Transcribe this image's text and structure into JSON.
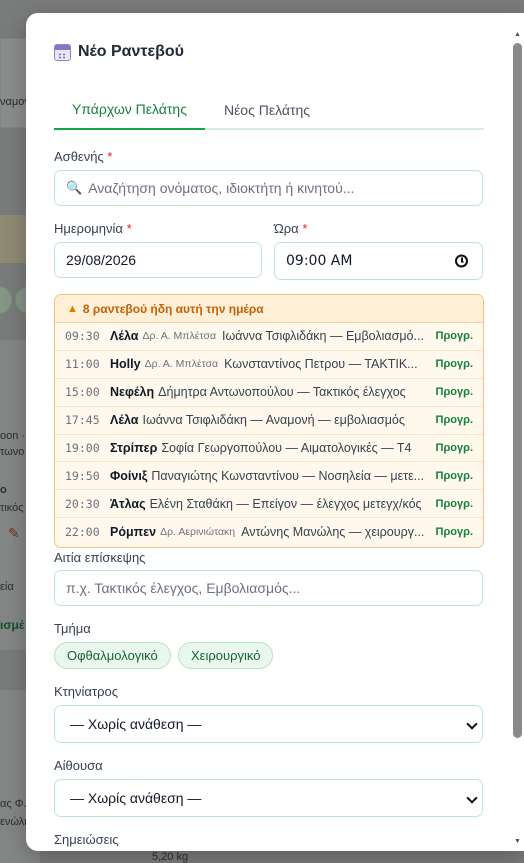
{
  "modal": {
    "title": "Νέο Ραντεβού",
    "tabs": [
      {
        "label": "Υπάρχων Πελάτης",
        "active": true
      },
      {
        "label": "Νέος Πελάτης",
        "active": false
      }
    ],
    "patient": {
      "label": "Ασθενής",
      "required_mark": "*",
      "search_icon": "magnifier-icon",
      "placeholder": "Αναζήτηση ονόματος, ιδιοκτήτη ή κινητού..."
    },
    "date": {
      "label": "Ημερομηνία",
      "required_mark": "*",
      "value": "29/08/2026"
    },
    "time": {
      "label": "Ώρα",
      "required_mark": "*",
      "value": "09:00 AM",
      "icon": "clock-icon"
    },
    "warning": {
      "icon": "warning-triangle-icon",
      "text": "8 ραντεβού ήδη αυτή την ημέρα",
      "appointments": [
        {
          "time": "09:30",
          "pet": "Λέλα",
          "vet": "Δρ. Α. Μπλέτσα",
          "desc": "Ιωάννα Τσιφλιδάκη — Εμβολιασμό...",
          "status": "Προγρ."
        },
        {
          "time": "11:00",
          "pet": "Holly",
          "vet": "Δρ. Α. Μπλέτσα",
          "desc": "Κωνσταντίνος Πετρου — ΤΑΚΤΙΚ...",
          "status": "Προγρ."
        },
        {
          "time": "15:00",
          "pet": "Νεφέλη",
          "vet": "",
          "desc": "Δήμητρα Αντωνοπούλου — Τακτικός έλεγχος",
          "status": "Προγρ."
        },
        {
          "time": "17:45",
          "pet": "Λέλα",
          "vet": "",
          "desc": "Ιωάννα Τσιφλιδάκη — Αναμονή — εμβολιασμός",
          "status": "Προγρ."
        },
        {
          "time": "19:00",
          "pet": "Στρίπερ",
          "vet": "",
          "desc": "Σοφία Γεωργοπούλου — Αιματολογικές — Τ4",
          "status": "Προγρ."
        },
        {
          "time": "19:50",
          "pet": "Φοίνιξ",
          "vet": "",
          "desc": "Παναγιώτης Κωνσταντίνου — Νοσηλεία — μετε...",
          "status": "Προγρ."
        },
        {
          "time": "20:30",
          "pet": "Άτλας",
          "vet": "",
          "desc": "Ελένη Σταθάκη — Επείγον — έλεγχος μετεγχ/κός",
          "status": "Προγρ."
        },
        {
          "time": "22:00",
          "pet": "Ρόμπεν",
          "vet": "Δρ. Αερινιώτακη",
          "desc": "Αντώνης Μανώλης — χειρουργ...",
          "status": "Προγρ."
        }
      ]
    },
    "reason": {
      "label": "Αιτία επίσκεψης",
      "placeholder": "π.χ. Τακτικός έλεγχος, Εμβολιασμός..."
    },
    "department": {
      "label": "Τμήμα",
      "options": [
        "Οφθαλμολογικό",
        "Χειρουργικό"
      ]
    },
    "vet_select": {
      "label": "Κτηνίατρος",
      "value": "— Χωρίς ανάθεση —"
    },
    "room_select": {
      "label": "Αίθουσα",
      "value": "— Χωρίς ανάθεση —"
    },
    "notes": {
      "label": "Σημειώσεις"
    }
  },
  "background": {
    "fragments": [
      "ναμον",
      "oon ·",
      "τωνο",
      "ο",
      "τικός ε",
      "εία",
      "ισμέ",
      "ας Φ.",
      "ενώλη",
      "5,20 kg"
    ]
  },
  "colors": {
    "accent": "#16a34a",
    "warning": "#c2620a",
    "required": "#dc2626"
  }
}
